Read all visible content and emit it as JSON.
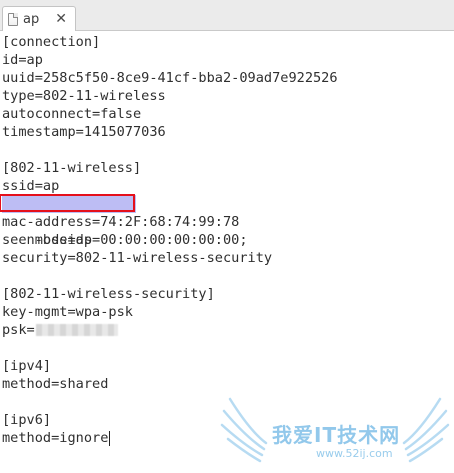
{
  "tab": {
    "title": "ap",
    "close_glyph": "✕",
    "icon": "text-file-icon"
  },
  "editor": {
    "lines": [
      "[connection]",
      "id=ap",
      "uuid=258c5f50-8ce9-41cf-bba2-09ad7e922526",
      "type=802-11-wireless",
      "autoconnect=false",
      "timestamp=1415077036",
      "",
      "[802-11-wireless]",
      "ssid=ap",
      "mode=ap",
      "mac-address=74:2F:68:74:99:78",
      "seen-bssids=00:00:00:00:00:00;",
      "security=802-11-wireless-security",
      "",
      "[802-11-wireless-security]",
      "key-mgmt=wpa-psk",
      "psk=",
      "",
      "[ipv4]",
      "method=shared",
      "",
      "[ipv6]",
      "method=ignore"
    ]
  },
  "watermark": {
    "text": "我爱IT技术网",
    "url": "www.52ij.com"
  },
  "colors": {
    "highlight": "#bdbdf4",
    "highlight_box": "#e5101b",
    "watermark": "#7fbfe8"
  }
}
